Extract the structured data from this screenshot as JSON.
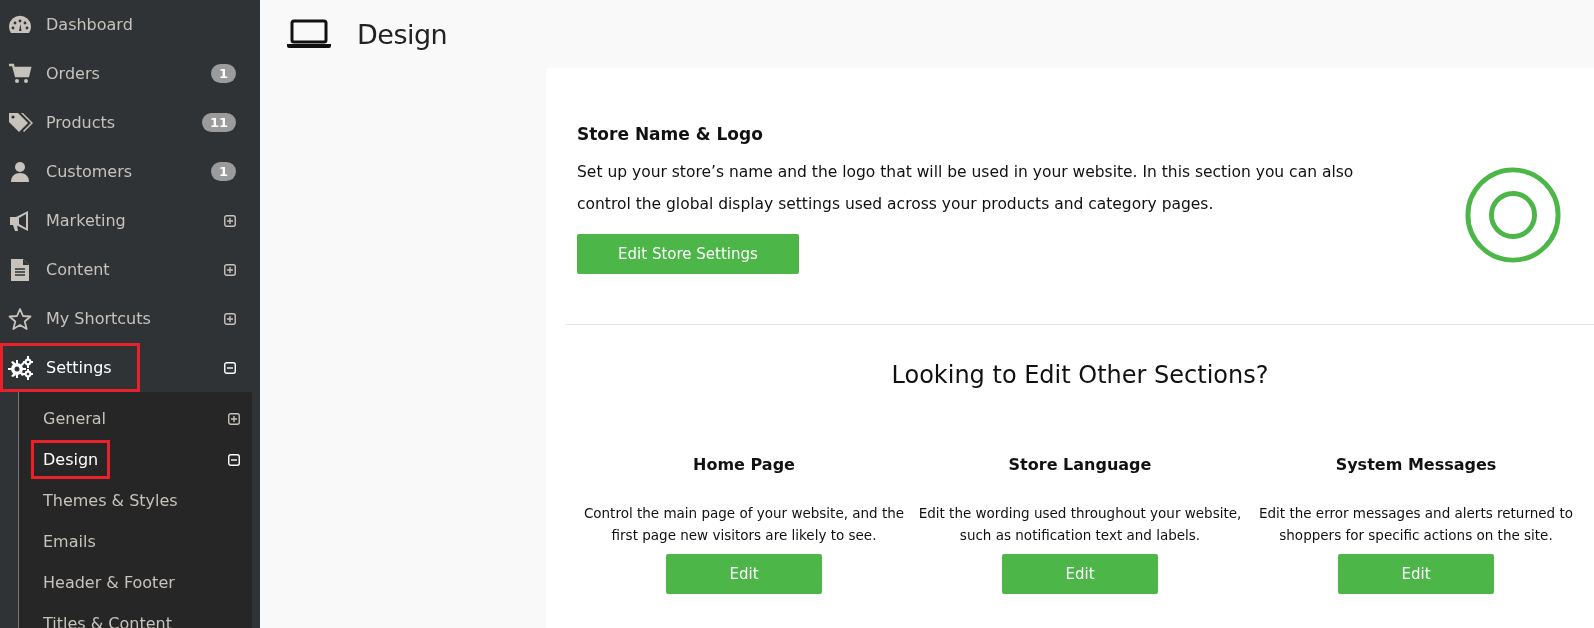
{
  "sidebar": {
    "items": [
      {
        "label": "Dashboard",
        "highlighted": false
      },
      {
        "label": "Orders",
        "badge": "1",
        "highlighted": false
      },
      {
        "label": "Products",
        "badge": "11",
        "highlighted": false
      },
      {
        "label": "Customers",
        "badge": "1",
        "highlighted": false
      },
      {
        "label": "Marketing",
        "expanded": false,
        "highlighted": false
      },
      {
        "label": "Content",
        "expanded": false,
        "highlighted": false
      },
      {
        "label": "My Shortcuts",
        "expanded": false,
        "highlighted": false
      },
      {
        "label": "Settings",
        "expanded": true,
        "highlighted": true,
        "children": [
          {
            "label": "General",
            "expanded": false,
            "highlighted": false
          },
          {
            "label": "Design",
            "expanded": true,
            "highlighted": true
          },
          {
            "label": "Themes & Styles",
            "highlighted": false
          },
          {
            "label": "Emails",
            "highlighted": false
          },
          {
            "label": "Header & Footer",
            "highlighted": false
          },
          {
            "label": "Titles & Content",
            "highlighted": false
          }
        ]
      }
    ]
  },
  "page": {
    "title": "Design"
  },
  "store_section": {
    "heading": "Store Name & Logo",
    "description": "Set up your store’s name and the logo that will be used in your website. In this section you can also control the global display settings used across your products and category pages.",
    "button": "Edit Store Settings"
  },
  "other_sections": {
    "heading": "Looking to Edit Other Sections?",
    "cards": [
      {
        "title": "Home Page",
        "description": "Control the main page of your website, and the first page new visitors are likely to see.",
        "button": "Edit"
      },
      {
        "title": "Store Language",
        "description": "Edit the wording used throughout your website, such as notification text and labels.",
        "button": "Edit"
      },
      {
        "title": "System Messages",
        "description": "Edit the error messages and alerts returned to shoppers for specific actions on the site.",
        "button": "Edit"
      }
    ]
  }
}
